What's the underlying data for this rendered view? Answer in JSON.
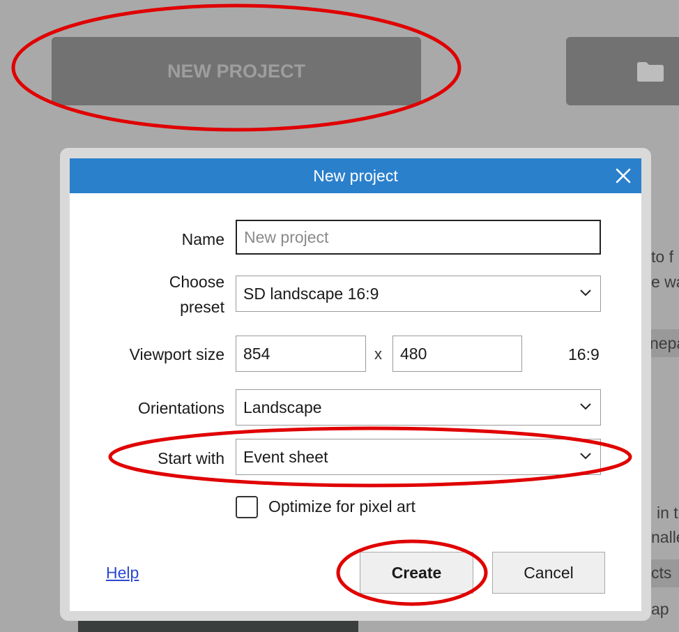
{
  "background": {
    "new_project_button": "NEW PROJECT",
    "right_text": [
      "to f",
      "e wa",
      "nepa",
      "in t",
      "nalle",
      "cts",
      "ap"
    ]
  },
  "dialog": {
    "title": "New project",
    "name_label": "Name",
    "name_placeholder": "New project",
    "preset_label_line1": "Choose",
    "preset_label_line2": "preset",
    "preset_value": "SD landscape 16:9",
    "viewport_label": "Viewport size",
    "viewport_width": "854",
    "viewport_separator": "x",
    "viewport_height": "480",
    "aspect_ratio": "16:9",
    "orientation_label": "Orientations",
    "orientation_value": "Landscape",
    "start_label": "Start with",
    "start_value": "Event sheet",
    "pixel_art_label": "Optimize for pixel art",
    "pixel_art_checked": false,
    "help_link": "Help",
    "create_button": "Create",
    "cancel_button": "Cancel"
  },
  "colors": {
    "titlebar": "#2b80cc",
    "annotation": "#e00000",
    "overlay_bg": "#a9a9a9"
  }
}
